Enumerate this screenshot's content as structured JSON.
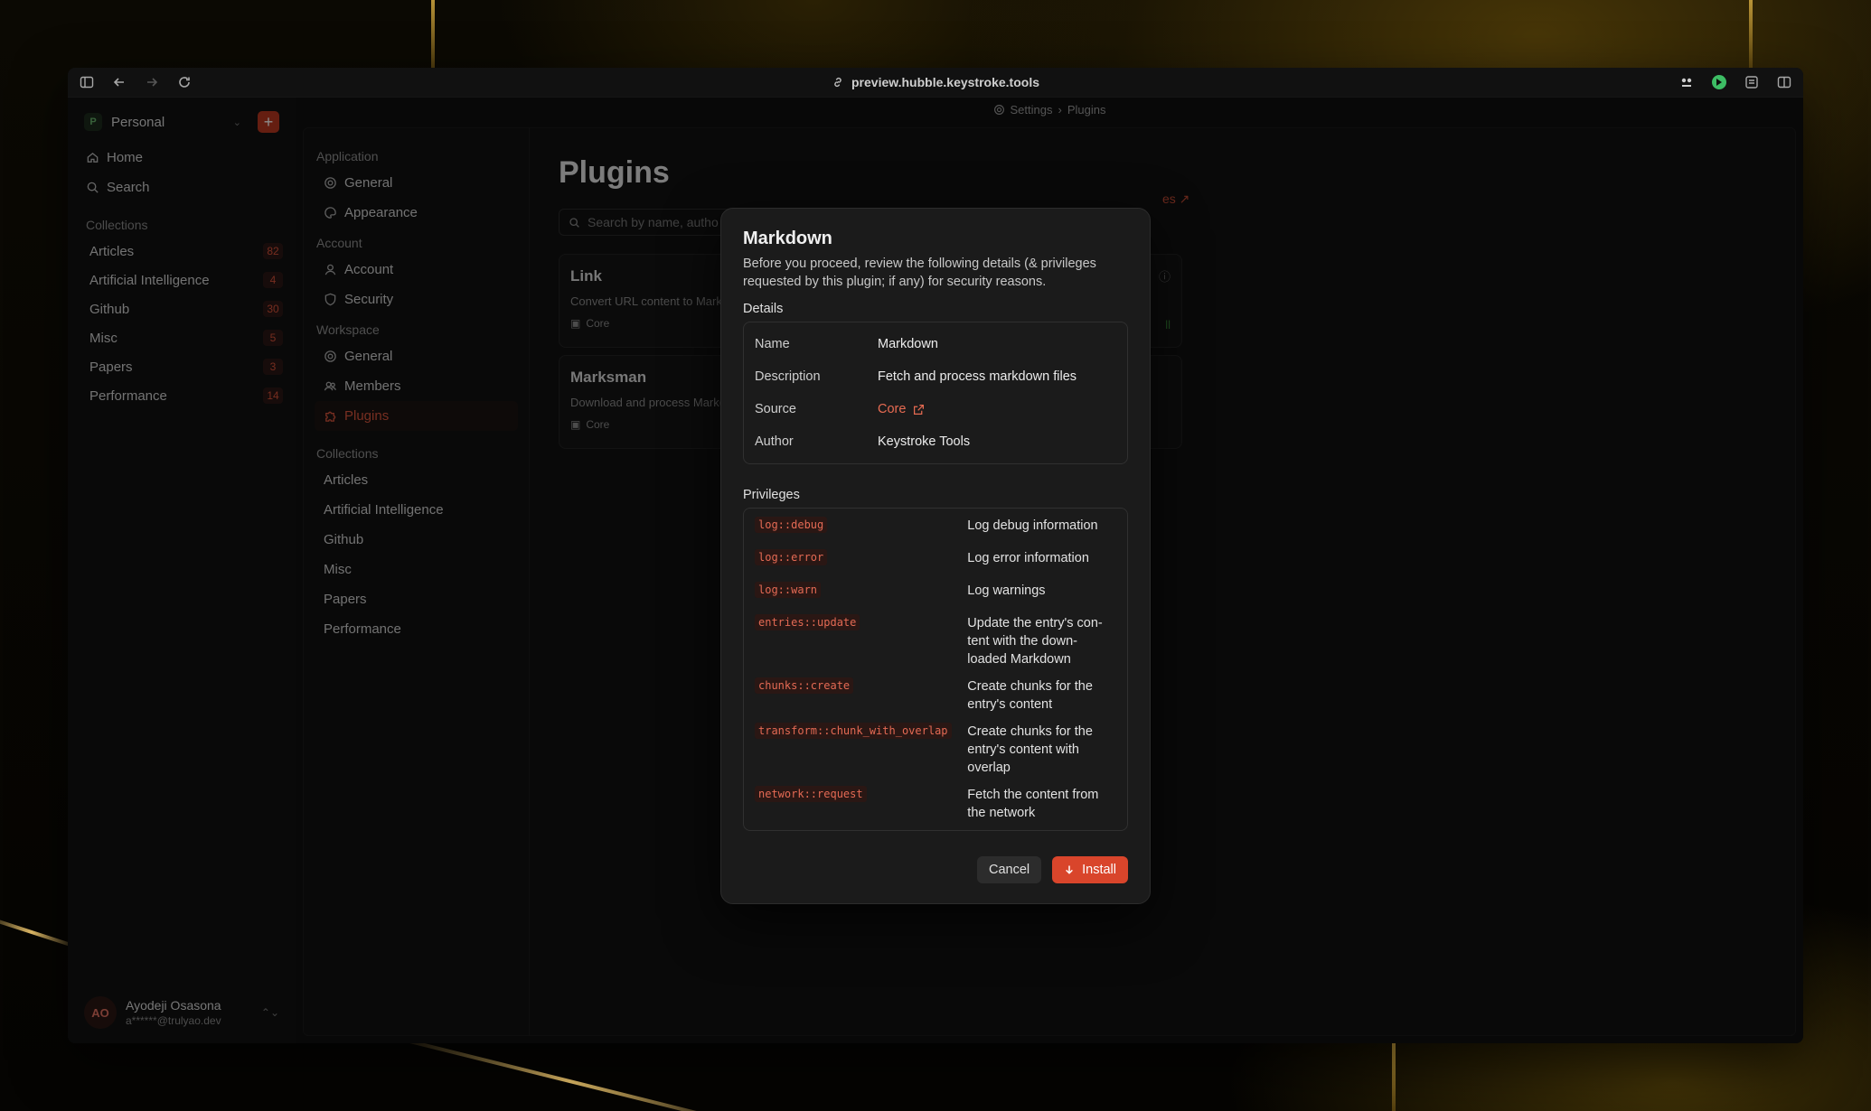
{
  "browser": {
    "url": "preview.hubble.keystroke.tools"
  },
  "workspace": {
    "name": "Personal",
    "initial": "P"
  },
  "sidebar": {
    "nav": [
      {
        "label": "Home"
      },
      {
        "label": "Search"
      }
    ],
    "collections_title": "Collections",
    "collections": [
      {
        "label": "Articles",
        "count": "82"
      },
      {
        "label": "Artificial Intelligence",
        "count": "4"
      },
      {
        "label": "Github",
        "count": "30"
      },
      {
        "label": "Misc",
        "count": "5"
      },
      {
        "label": "Papers",
        "count": "3"
      },
      {
        "label": "Performance",
        "count": "14"
      }
    ],
    "user": {
      "initials": "AO",
      "name": "Ayodeji Osasona",
      "email": "a******@trulyao.dev"
    }
  },
  "breadcrumb": {
    "root": "Settings",
    "current": "Plugins"
  },
  "settings_nav": {
    "application": {
      "title": "Application",
      "items": [
        "General",
        "Appearance"
      ]
    },
    "account": {
      "title": "Account",
      "items": [
        "Account",
        "Security"
      ]
    },
    "workspace": {
      "title": "Workspace",
      "items": [
        "General",
        "Members",
        "Plugins"
      ]
    },
    "collections": {
      "title": "Collections",
      "items": [
        "Articles",
        "Artificial Intelligence",
        "Github",
        "Misc",
        "Papers",
        "Performance"
      ]
    }
  },
  "plugins_page": {
    "title": "Plugins",
    "search_placeholder": "Search by name, autho",
    "manage_link": "es ↗",
    "cards": [
      {
        "title": "Link",
        "description": "Convert URL content to Mark",
        "source": "Core",
        "right": "ll"
      },
      {
        "title": "Marksman",
        "description": "Download and process Mark(",
        "source": "Core"
      }
    ]
  },
  "modal": {
    "title": "Markdown",
    "intro": "Before you proceed, review the following details (& privileges requested by this plugin; if any) for security reasons.",
    "details_title": "Details",
    "details": [
      {
        "key": "Name",
        "value": "Markdown"
      },
      {
        "key": "Description",
        "value": "Fetch and process markdown files"
      },
      {
        "key": "Source",
        "value": "Core"
      },
      {
        "key": "Author",
        "value": "Keystroke Tools"
      }
    ],
    "privileges_title": "Privileges",
    "privileges": [
      {
        "code": "log::debug",
        "desc": "Log debug information"
      },
      {
        "code": "log::error",
        "desc": "Log error information"
      },
      {
        "code": "log::warn",
        "desc": "Log warnings"
      },
      {
        "code": "entries::update",
        "desc": "Update the entry's con-tent with the down-loaded Markdown"
      },
      {
        "code": "chunks::create",
        "desc": "Create chunks for the entry's content"
      },
      {
        "code": "transform::chunk_with_overlap",
        "desc": "Create chunks for the entry's content with overlap"
      },
      {
        "code": "network::request",
        "desc": "Fetch the content from the network"
      }
    ],
    "cancel_label": "Cancel",
    "install_label": "Install"
  }
}
